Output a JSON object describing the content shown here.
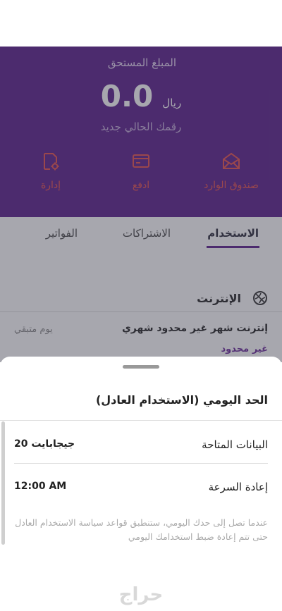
{
  "header": {
    "amount_label": "المبلغ المستحق",
    "amount_value": "0.0",
    "currency": "ريال",
    "balance_note": "رقمك الحالي جديد",
    "accent_color": "#5a1e8a"
  },
  "actions": [
    {
      "label": "صندوق الوارد",
      "icon": "inbox-envelope-icon"
    },
    {
      "label": "ادفع",
      "icon": "credit-card-icon"
    },
    {
      "label": "إدارة",
      "icon": "document-gear-icon"
    }
  ],
  "tabs": [
    {
      "label": "الاستخدام",
      "active": true
    },
    {
      "label": "الاشتراكات",
      "active": false
    },
    {
      "label": "الفواتير",
      "active": false
    }
  ],
  "section": {
    "title": "الإنترنت",
    "icon": "internet-globe-icon",
    "plan_name": "إنترنت شهر غير محدود شهري",
    "plan_sub": "غير محدود",
    "remaining": "يوم متبقي"
  },
  "sheet": {
    "title": "الحد اليومي (الاستخدام العادل)",
    "rows": [
      {
        "label": "البيانات المتاحة",
        "value": "20 جيجابايت"
      },
      {
        "label": "إعادة السرعة",
        "value": "12:00 AM"
      }
    ],
    "note": "عندما تصل إلى حدك اليومي، ستنطبق قواعد سياسة الاستخدام العادل حتى تتم إعادة ضبط استخدامك اليومي"
  },
  "watermark": "حراج"
}
